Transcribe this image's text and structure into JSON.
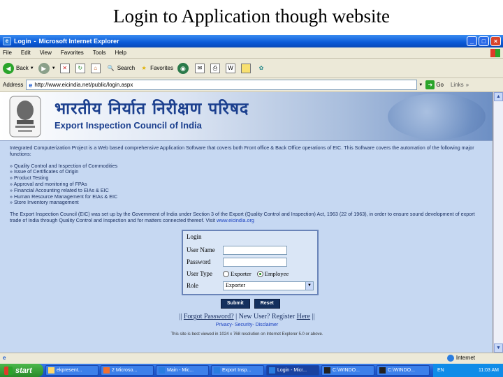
{
  "slide": {
    "title": "Login to Application though website"
  },
  "window": {
    "title_app": "Login",
    "title_sep": "-",
    "title_browser": "Microsoft Internet Explorer"
  },
  "menu": [
    "File",
    "Edit",
    "View",
    "Favorites",
    "Tools",
    "Help"
  ],
  "toolbar": {
    "back": "Back",
    "search": "Search",
    "favorites": "Favorites"
  },
  "address": {
    "label": "Address",
    "url": "http://www.eicindia.net/public/login.aspx",
    "go": "Go",
    "links": "Links"
  },
  "banner": {
    "hindi": "भारतीय निर्यात निरीक्षण परिषद",
    "english": "Export Inspection Council of India"
  },
  "content": {
    "intro": "Integrated Computerization Project is a Web based comprehensive Application Software that covers both Front office & Back Office operations of EIC. This Software covers the automation of the following major functions:",
    "functions": [
      "» Quality Control and Inspection of Commodities",
      "» Issue of Certificates of Origin",
      "» Product Testing",
      "» Approval and monitoring of FPAs",
      "» Financial Accounting related to EIAs & EIC",
      "» Human Resource Management for EIAs & EIC",
      "» Store Inventory management"
    ],
    "about": "The Export Inspection Council (EIC) was set up by the Government of India under Section 3 of the Export (Quality Control and Inspection) Act, 1963 (22 of 1963), in order to ensure sound development of export trade of India through Quality Control and Inspection and for matters connected thereof. Visit",
    "about_link": "www.eicindia.org"
  },
  "login": {
    "title": "Login",
    "username_label": "User Name",
    "password_label": "Password",
    "usertype_label": "User Type",
    "usertype_options": [
      "Exporter",
      "Employee"
    ],
    "usertype_selected": "Employee",
    "role_label": "Role",
    "role_value": "Exporter",
    "submit": "Submit",
    "reset": "Reset"
  },
  "links": {
    "pre": "||",
    "forgot": "Forgot Password?",
    "mid": "| New User? Register",
    "here": "Here",
    "post": "||",
    "privacy": "Privacy",
    "security": "Security",
    "disclaimer": "Disclaimer",
    "best_view": "This site is best viewed in 1024 x 768 resolution on Internet Explorer 5.0 or above."
  },
  "status": {
    "zone": "Internet"
  },
  "taskbar": {
    "start": "start",
    "tasks": [
      "ekpresent...",
      "2 Microso...",
      "Main - Mic...",
      "Export Insp...",
      "Login - Micr...",
      "C:\\WINDO...",
      "C:\\WINDO..."
    ],
    "active_task": 4,
    "lang": "EN",
    "clock": "11:03 AM"
  }
}
